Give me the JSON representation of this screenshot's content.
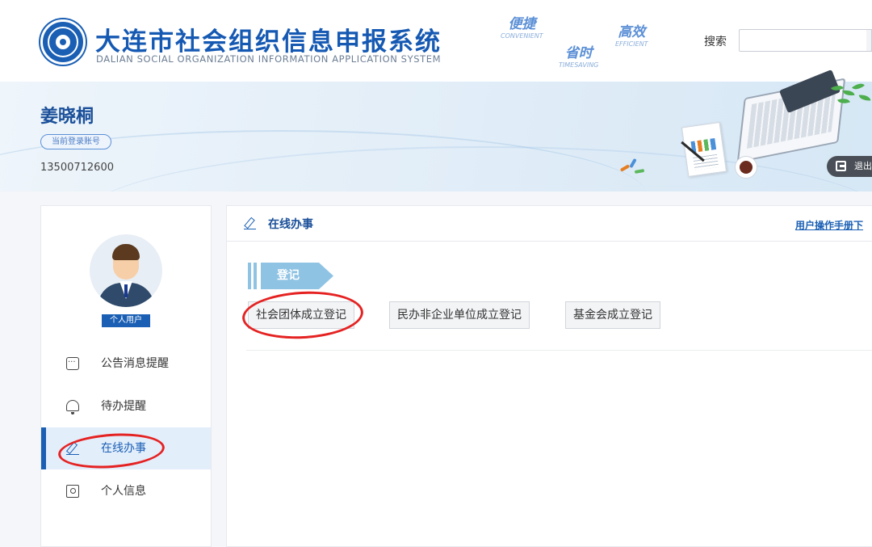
{
  "header": {
    "title": "大连市社会组织信息申报系统",
    "subtitle": "DALIAN SOCIAL ORGANIZATION INFORMATION APPLICATION SYSTEM",
    "slogans": [
      {
        "cn": "便捷",
        "en": "CONVENIENT"
      },
      {
        "cn": "省时",
        "en": "TIMESAVING"
      },
      {
        "cn": "高效",
        "en": "EFFICIENT"
      }
    ],
    "search_label": "搜索",
    "search_value": "",
    "search_placeholder": ""
  },
  "banner": {
    "user_name": "姜晓桐",
    "account_tag": "当前登录账号",
    "account_number": "13500712600",
    "logout_label": "退出"
  },
  "sidebar": {
    "user_type": "个人用户",
    "items": [
      {
        "label": "公告消息提醒",
        "icon": "message-icon",
        "active": false
      },
      {
        "label": "待办提醒",
        "icon": "bell-icon",
        "active": false
      },
      {
        "label": "在线办事",
        "icon": "edit-icon",
        "active": true
      },
      {
        "label": "个人信息",
        "icon": "user-card-icon",
        "active": false
      }
    ]
  },
  "main": {
    "title": "在线办事",
    "manual_link": "用户操作手册下",
    "section_label": "登记",
    "buttons": [
      {
        "label": "社会团体成立登记"
      },
      {
        "label": "民办非企业单位成立登记"
      },
      {
        "label": "基金会成立登记"
      }
    ]
  },
  "colors": {
    "brand_blue": "#1559b3",
    "active_bg": "#e3eefb",
    "ribbon": "#8fc3e4",
    "annotation_red": "#e52222"
  }
}
